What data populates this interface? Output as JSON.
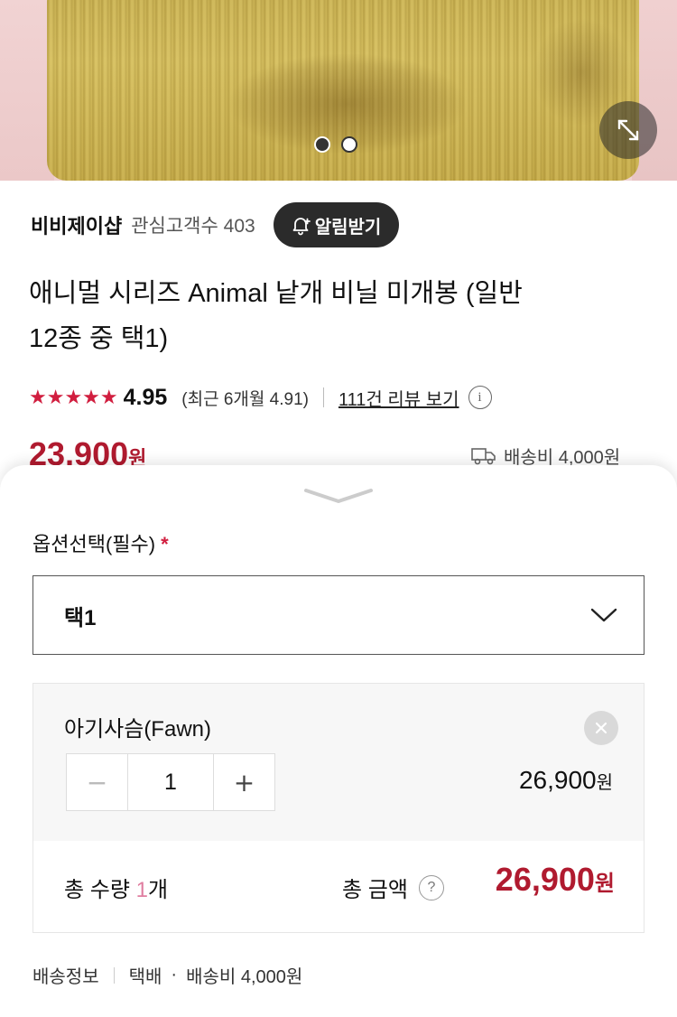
{
  "hero": {
    "carousel_dots": [
      {
        "active": true
      },
      {
        "active": false
      }
    ],
    "expand_icon": "expand-arrows-icon"
  },
  "store": {
    "name": "비비제이샵",
    "followers": "관심고객수 403",
    "alarm_label": "알림받기",
    "alarm_icon": "bell-plus-icon"
  },
  "product": {
    "title_line1": "애니멀 시리즈 Animal 낱개 비닐 미개봉 (일반",
    "title_line2": "12종 중 택1)",
    "stars": "★★★★★",
    "rating": "4.95",
    "recent_rating": "(최근 6개월 4.91)",
    "review_link": "111건 리뷰 보기",
    "price_value": "23,900",
    "price_unit": "원",
    "shipping_peek": "배송비 4,000원"
  },
  "sheet": {
    "option_label": "옵션선택(필수)",
    "required_mark": "*",
    "selected_option": "택1",
    "item": {
      "name": "아기사슴(Fawn)",
      "quantity": "1",
      "minus": "−",
      "plus": "+",
      "price_value": "26,900",
      "price_unit": "원"
    },
    "total": {
      "qty_prefix": "총 수량 ",
      "qty_num": "1",
      "qty_suffix": "개",
      "label": "총 금액",
      "help": "?",
      "price_value": "26,900",
      "price_unit": "원"
    },
    "shipping": {
      "label": "배송정보",
      "method": "택배",
      "bullet": "·",
      "fee": "배송비 4,000원"
    }
  },
  "colors": {
    "accent_red": "#b01a2f",
    "star_red": "#d11e3f",
    "qty_pink": "#e07ea0",
    "dark_button": "#2b2b2b"
  }
}
